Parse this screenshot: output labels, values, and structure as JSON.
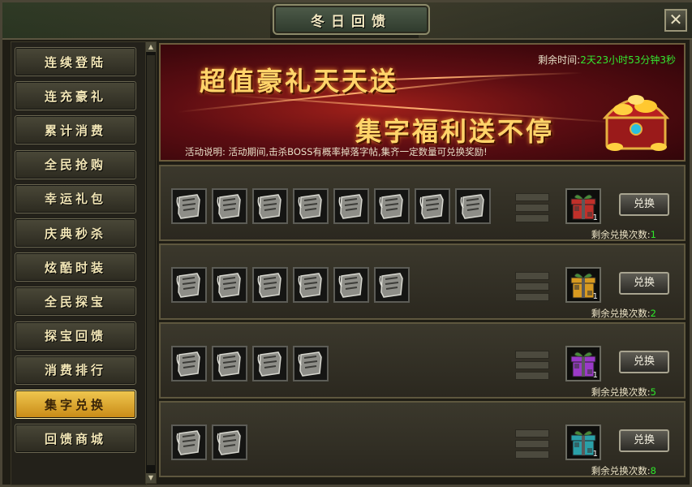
{
  "window": {
    "title": "冬日回馈",
    "close_label": "✕"
  },
  "sidebar": {
    "items": [
      {
        "label": "连续登陆",
        "active": false
      },
      {
        "label": "连充豪礼",
        "active": false
      },
      {
        "label": "累计消费",
        "active": false
      },
      {
        "label": "全民抢购",
        "active": false
      },
      {
        "label": "幸运礼包",
        "active": false
      },
      {
        "label": "庆典秒杀",
        "active": false
      },
      {
        "label": "炫酷时装",
        "active": false
      },
      {
        "label": "全民探宝",
        "active": false
      },
      {
        "label": "探宝回馈",
        "active": false
      },
      {
        "label": "消费排行",
        "active": false
      },
      {
        "label": "集字兑换",
        "active": true
      },
      {
        "label": "回馈商城",
        "active": false
      }
    ]
  },
  "banner": {
    "headline1": "超值豪礼天天送",
    "headline2": "集字福利送不停",
    "remain_label": "剩余时间:",
    "remain_value": "2天23小时53分钟3秒",
    "desc_label": "活动说明:",
    "desc_text": "活动期间,击杀BOSS有概率掉落字帖,集齐一定数量可兑换奖励!"
  },
  "exchange": {
    "button_label": "兑换",
    "remaining_label": "剩余兑换次数:",
    "rows": [
      {
        "slots": 8,
        "gift_color": "#c0302a",
        "reward_count": "1",
        "remaining": "1"
      },
      {
        "slots": 6,
        "gift_color": "#d89a20",
        "reward_count": "1",
        "remaining": "2"
      },
      {
        "slots": 4,
        "gift_color": "#9a3ac8",
        "reward_count": "1",
        "remaining": "5"
      },
      {
        "slots": 2,
        "gift_color": "#2aa0a8",
        "reward_count": "1",
        "remaining": "8"
      }
    ]
  }
}
